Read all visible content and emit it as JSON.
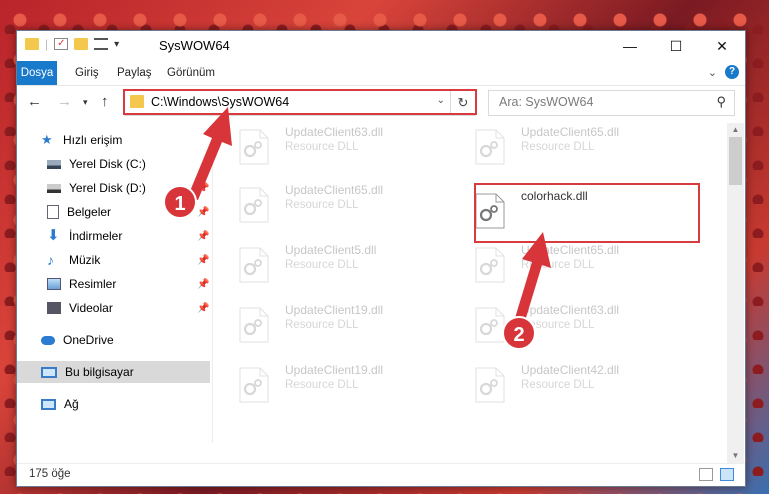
{
  "window": {
    "title": "SysWOW64",
    "quick_access_dropdown": "▾"
  },
  "ribbon": {
    "tabs": [
      "Dosya",
      "Giriş",
      "Paylaş",
      "Görünüm"
    ],
    "expand": "⌄",
    "help": "?"
  },
  "nav": {
    "address": "C:\\Windows\\SysWOW64",
    "search_placeholder": "Ara: SysWOW64"
  },
  "sidebar": {
    "items": [
      {
        "label": "Hızlı erişim",
        "icon": "star-icon"
      },
      {
        "label": "Yerel Disk (C:)",
        "icon": "drive-icon"
      },
      {
        "label": "Yerel Disk (D:)",
        "icon": "drive-icon"
      },
      {
        "label": "Belgeler",
        "icon": "documents-icon"
      },
      {
        "label": "İndirmeler",
        "icon": "download-icon"
      },
      {
        "label": "Müzik",
        "icon": "music-icon"
      },
      {
        "label": "Resimler",
        "icon": "pictures-icon"
      },
      {
        "label": "Videolar",
        "icon": "video-icon"
      },
      {
        "label": "OneDrive",
        "icon": "cloud-icon"
      },
      {
        "label": "Bu bilgisayar",
        "icon": "computer-icon"
      },
      {
        "label": "Ağ",
        "icon": "network-icon"
      }
    ]
  },
  "files": [
    {
      "name": "UpdateClient63.dll",
      "type": "Resource DLL"
    },
    {
      "name": "UpdateClient65.dll",
      "type": "Resource DLL"
    },
    {
      "name": "UpdateClient65.dll",
      "type": "Resource DLL"
    },
    {
      "name": "colorhack.dll",
      "type": ""
    },
    {
      "name": "UpdateClient5.dll",
      "type": "Resource DLL"
    },
    {
      "name": "UpdateClient65.dll",
      "type": "Resource DLL"
    },
    {
      "name": "UpdateClient19.dll",
      "type": "Resource DLL"
    },
    {
      "name": "UpdateClient63.dll",
      "type": "Resource DLL"
    },
    {
      "name": "UpdateClient19.dll",
      "type": "Resource DLL"
    },
    {
      "name": "UpdateClient42.dll",
      "type": "Resource DLL"
    }
  ],
  "status": {
    "count": "175 öğe"
  },
  "markers": [
    "1",
    "2"
  ],
  "colors": {
    "accent": "#1979ca",
    "highlight": "#d83a3e"
  }
}
